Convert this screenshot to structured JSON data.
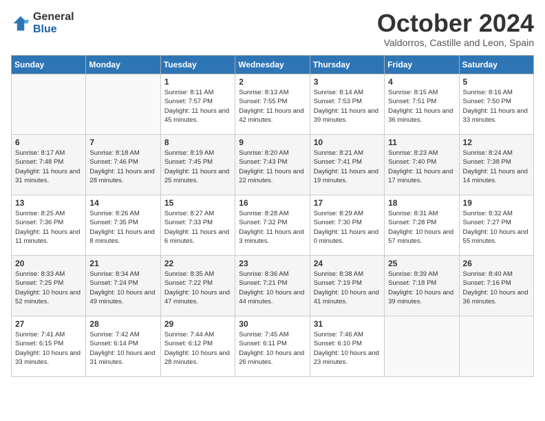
{
  "header": {
    "logo_general": "General",
    "logo_blue": "Blue",
    "month_title": "October 2024",
    "location": "Valdorros, Castille and Leon, Spain"
  },
  "days_of_week": [
    "Sunday",
    "Monday",
    "Tuesday",
    "Wednesday",
    "Thursday",
    "Friday",
    "Saturday"
  ],
  "weeks": [
    [
      {
        "day": "",
        "info": ""
      },
      {
        "day": "",
        "info": ""
      },
      {
        "day": "1",
        "info": "Sunrise: 8:11 AM\nSunset: 7:57 PM\nDaylight: 11 hours and 45 minutes."
      },
      {
        "day": "2",
        "info": "Sunrise: 8:13 AM\nSunset: 7:55 PM\nDaylight: 11 hours and 42 minutes."
      },
      {
        "day": "3",
        "info": "Sunrise: 8:14 AM\nSunset: 7:53 PM\nDaylight: 11 hours and 39 minutes."
      },
      {
        "day": "4",
        "info": "Sunrise: 8:15 AM\nSunset: 7:51 PM\nDaylight: 11 hours and 36 minutes."
      },
      {
        "day": "5",
        "info": "Sunrise: 8:16 AM\nSunset: 7:50 PM\nDaylight: 11 hours and 33 minutes."
      }
    ],
    [
      {
        "day": "6",
        "info": "Sunrise: 8:17 AM\nSunset: 7:48 PM\nDaylight: 11 hours and 31 minutes."
      },
      {
        "day": "7",
        "info": "Sunrise: 8:18 AM\nSunset: 7:46 PM\nDaylight: 11 hours and 28 minutes."
      },
      {
        "day": "8",
        "info": "Sunrise: 8:19 AM\nSunset: 7:45 PM\nDaylight: 11 hours and 25 minutes."
      },
      {
        "day": "9",
        "info": "Sunrise: 8:20 AM\nSunset: 7:43 PM\nDaylight: 11 hours and 22 minutes."
      },
      {
        "day": "10",
        "info": "Sunrise: 8:21 AM\nSunset: 7:41 PM\nDaylight: 11 hours and 19 minutes."
      },
      {
        "day": "11",
        "info": "Sunrise: 8:23 AM\nSunset: 7:40 PM\nDaylight: 11 hours and 17 minutes."
      },
      {
        "day": "12",
        "info": "Sunrise: 8:24 AM\nSunset: 7:38 PM\nDaylight: 11 hours and 14 minutes."
      }
    ],
    [
      {
        "day": "13",
        "info": "Sunrise: 8:25 AM\nSunset: 7:36 PM\nDaylight: 11 hours and 11 minutes."
      },
      {
        "day": "14",
        "info": "Sunrise: 8:26 AM\nSunset: 7:35 PM\nDaylight: 11 hours and 8 minutes."
      },
      {
        "day": "15",
        "info": "Sunrise: 8:27 AM\nSunset: 7:33 PM\nDaylight: 11 hours and 6 minutes."
      },
      {
        "day": "16",
        "info": "Sunrise: 8:28 AM\nSunset: 7:32 PM\nDaylight: 11 hours and 3 minutes."
      },
      {
        "day": "17",
        "info": "Sunrise: 8:29 AM\nSunset: 7:30 PM\nDaylight: 11 hours and 0 minutes."
      },
      {
        "day": "18",
        "info": "Sunrise: 8:31 AM\nSunset: 7:28 PM\nDaylight: 10 hours and 57 minutes."
      },
      {
        "day": "19",
        "info": "Sunrise: 8:32 AM\nSunset: 7:27 PM\nDaylight: 10 hours and 55 minutes."
      }
    ],
    [
      {
        "day": "20",
        "info": "Sunrise: 8:33 AM\nSunset: 7:25 PM\nDaylight: 10 hours and 52 minutes."
      },
      {
        "day": "21",
        "info": "Sunrise: 8:34 AM\nSunset: 7:24 PM\nDaylight: 10 hours and 49 minutes."
      },
      {
        "day": "22",
        "info": "Sunrise: 8:35 AM\nSunset: 7:22 PM\nDaylight: 10 hours and 47 minutes."
      },
      {
        "day": "23",
        "info": "Sunrise: 8:36 AM\nSunset: 7:21 PM\nDaylight: 10 hours and 44 minutes."
      },
      {
        "day": "24",
        "info": "Sunrise: 8:38 AM\nSunset: 7:19 PM\nDaylight: 10 hours and 41 minutes."
      },
      {
        "day": "25",
        "info": "Sunrise: 8:39 AM\nSunset: 7:18 PM\nDaylight: 10 hours and 39 minutes."
      },
      {
        "day": "26",
        "info": "Sunrise: 8:40 AM\nSunset: 7:16 PM\nDaylight: 10 hours and 36 minutes."
      }
    ],
    [
      {
        "day": "27",
        "info": "Sunrise: 7:41 AM\nSunset: 6:15 PM\nDaylight: 10 hours and 33 minutes."
      },
      {
        "day": "28",
        "info": "Sunrise: 7:42 AM\nSunset: 6:14 PM\nDaylight: 10 hours and 31 minutes."
      },
      {
        "day": "29",
        "info": "Sunrise: 7:44 AM\nSunset: 6:12 PM\nDaylight: 10 hours and 28 minutes."
      },
      {
        "day": "30",
        "info": "Sunrise: 7:45 AM\nSunset: 6:11 PM\nDaylight: 10 hours and 26 minutes."
      },
      {
        "day": "31",
        "info": "Sunrise: 7:46 AM\nSunset: 6:10 PM\nDaylight: 10 hours and 23 minutes."
      },
      {
        "day": "",
        "info": ""
      },
      {
        "day": "",
        "info": ""
      }
    ]
  ]
}
